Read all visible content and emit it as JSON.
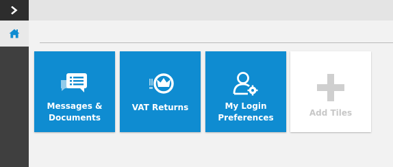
{
  "sidebar": {
    "toggle_icon": "chevron-right-icon",
    "home_icon": "home-icon",
    "accent": "#0f8cd1"
  },
  "tiles": [
    {
      "label_line1": "Messages &",
      "label_line2": "Documents",
      "icon": "messages-icon"
    },
    {
      "label": "VAT Returns",
      "icon": "vat-crown-icon"
    },
    {
      "label_line1": "My Login",
      "label_line2": "Preferences",
      "icon": "user-settings-icon"
    },
    {
      "label": "Add Tiles",
      "icon": "plus-icon"
    }
  ],
  "colors": {
    "tile_blue": "#0f8cd1",
    "sidebar_dark": "#3f3f3f",
    "add_tile_text": "#c8c8c8"
  }
}
